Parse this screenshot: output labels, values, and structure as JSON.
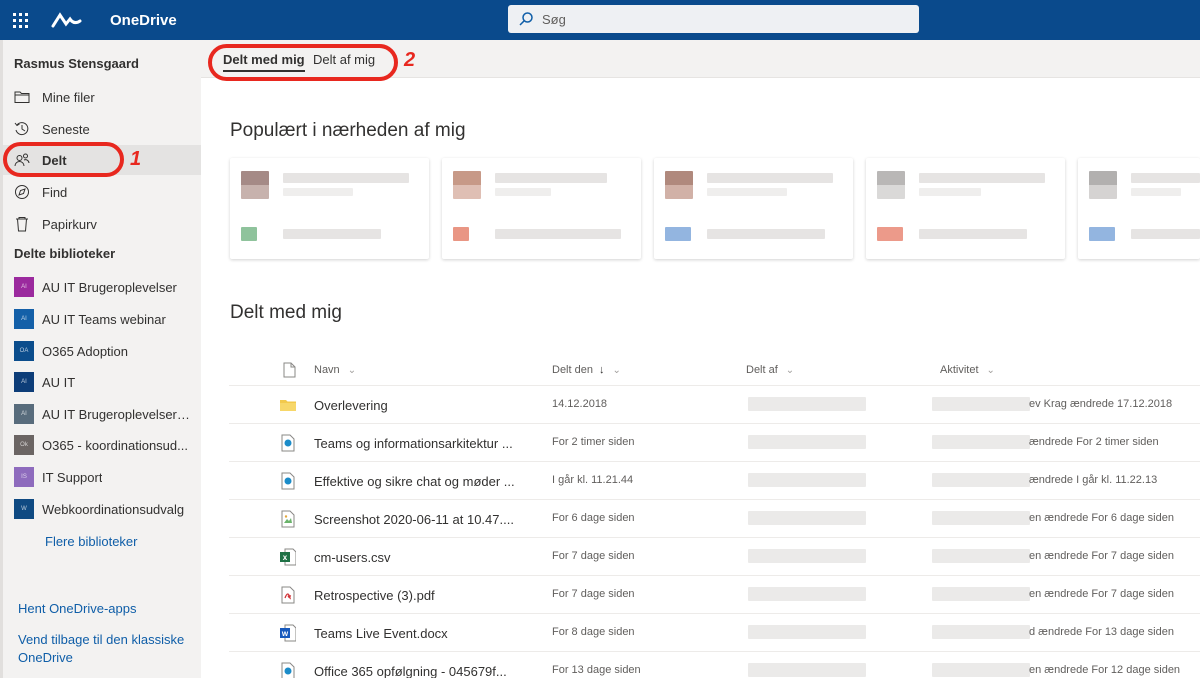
{
  "topbar": {
    "app_name": "OneDrive",
    "search_placeholder": "Søg"
  },
  "sidebar": {
    "user": "Rasmus Stensgaard",
    "nav": [
      {
        "label": "Mine filer",
        "icon": "folder-icon"
      },
      {
        "label": "Seneste",
        "icon": "recent-icon"
      },
      {
        "label": "Delt",
        "icon": "shared-people-icon",
        "active": true
      },
      {
        "label": "Find",
        "icon": "discover-icon"
      },
      {
        "label": "Papirkurv",
        "icon": "recycle-bin-icon"
      }
    ],
    "libraries_title": "Delte biblioteker",
    "libraries": [
      {
        "label": "AU IT Brugeroplevelser",
        "color": "#9b2a9e"
      },
      {
        "label": "AU IT Teams webinar",
        "color": "#1460a8"
      },
      {
        "label": "O365 Adoption",
        "color": "#0b4d8c"
      },
      {
        "label": "AU IT",
        "color": "#0d3d78"
      },
      {
        "label": "AU IT Brugeroplevelser -...",
        "color": "#586c7c"
      },
      {
        "label": "O365 - koordinationsud...",
        "color": "#6b6563"
      },
      {
        "label": "IT Support",
        "color": "#8e6bbd"
      },
      {
        "label": "Webkoordinationsudvalg",
        "color": "#0f4a82"
      }
    ],
    "more_libraries": "Flere biblioteker",
    "get_apps": "Hent OneDrive-apps",
    "classic_line1": "Vend tilbage til den klassiske",
    "classic_line2": "OneDrive"
  },
  "pivot": {
    "tab1": "Delt med mig",
    "tab2": "Delt af mig"
  },
  "annotations": {
    "num1": "1",
    "num2": "2"
  },
  "main": {
    "popular_title": "Populært i nærheden af mig",
    "shared_title": "Delt med mig",
    "columns": {
      "name": "Navn",
      "shared_date": "Delt den",
      "shared_by": "Delt af",
      "activity": "Aktivitet"
    },
    "rows": [
      {
        "name": "Overlevering",
        "date": "14.12.2018",
        "activity": "ev Krag ændrede 17.12.2018",
        "icon": "folder-icon"
      },
      {
        "name": "Teams og informationsarkitektur ...",
        "date": "For 2 timer siden",
        "activity": "ændrede For 2 timer siden",
        "icon": "sharepoint-page-icon"
      },
      {
        "name": "Effektive og sikre chat og møder ...",
        "date": "I går kl. 11.21.44",
        "activity": "ændrede I går kl. 11.22.13",
        "icon": "sharepoint-page-icon"
      },
      {
        "name": "Screenshot 2020-06-11 at 10.47....",
        "date": "For 6 dage siden",
        "activity": "en ændrede For 6 dage siden",
        "icon": "image-file-icon"
      },
      {
        "name": "cm-users.csv",
        "date": "For 7 dage siden",
        "activity": "en ændrede For 7 dage siden",
        "icon": "excel-file-icon"
      },
      {
        "name": "Retrospective (3).pdf",
        "date": "For 7 dage siden",
        "activity": "en ændrede For 7 dage siden",
        "icon": "pdf-file-icon"
      },
      {
        "name": "Teams Live Event.docx",
        "date": "For 8 dage siden",
        "activity": "d ændrede For 13 dage siden",
        "icon": "word-file-icon"
      },
      {
        "name": "Office 365 opfølgning - 045679f...",
        "date": "For 13 dage siden",
        "activity": "en ændrede For 12 dage siden",
        "icon": "sharepoint-page-icon"
      }
    ]
  }
}
